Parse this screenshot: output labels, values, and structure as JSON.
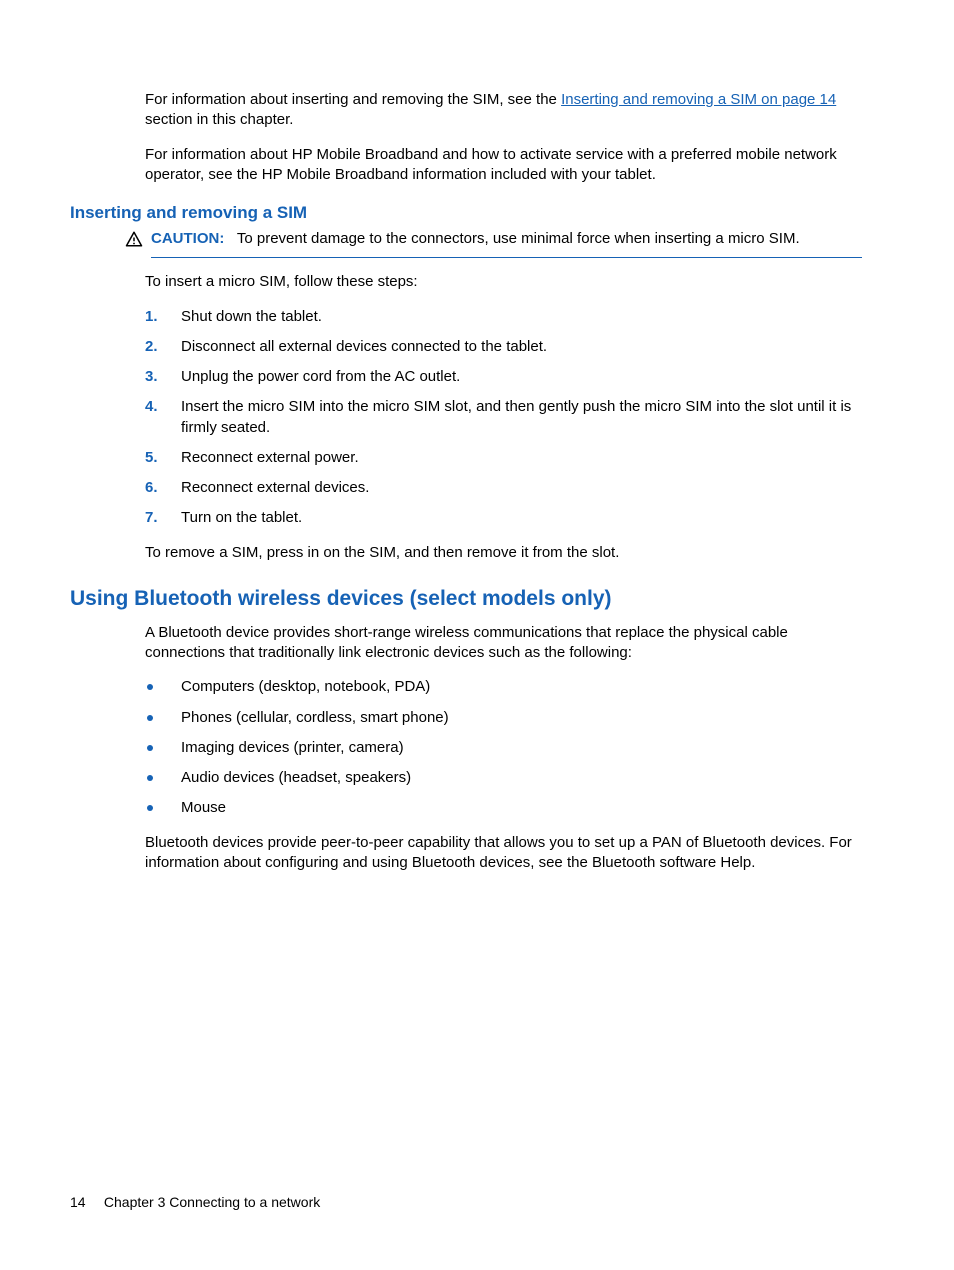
{
  "intro": {
    "p1a": "For information about inserting and removing the SIM, see the ",
    "link": "Inserting and removing a SIM on page 14",
    "p1b": " section in this chapter.",
    "p2": "For information about HP Mobile Broadband and how to activate service with a preferred mobile network operator, see the HP Mobile Broadband information included with your tablet."
  },
  "sim": {
    "heading": "Inserting and removing a SIM",
    "caution_label": "CAUTION:",
    "caution_text": "To prevent damage to the connectors, use minimal force when inserting a micro SIM.",
    "lead": "To insert a micro SIM, follow these steps:",
    "steps": [
      "Shut down the tablet.",
      "Disconnect all external devices connected to the tablet.",
      "Unplug the power cord from the AC outlet.",
      "Insert the micro SIM into the micro SIM slot, and then gently push the micro SIM into the slot until it is firmly seated.",
      "Reconnect external power.",
      "Reconnect external devices.",
      "Turn on the tablet."
    ],
    "remove": "To remove a SIM, press in on the SIM, and then remove it from the slot."
  },
  "bt": {
    "heading": "Using Bluetooth wireless devices (select models only)",
    "p1": "A Bluetooth device provides short-range wireless communications that replace the physical cable connections that traditionally link electronic devices such as the following:",
    "items": [
      "Computers (desktop, notebook, PDA)",
      "Phones (cellular, cordless, smart phone)",
      "Imaging devices (printer, camera)",
      "Audio devices (headset, speakers)",
      "Mouse"
    ],
    "p2": "Bluetooth devices provide peer-to-peer capability that allows you to set up a PAN of Bluetooth devices. For information about configuring and using Bluetooth devices, see the Bluetooth software Help."
  },
  "footer": {
    "page": "14",
    "chapter": "Chapter 3   Connecting to a network"
  }
}
